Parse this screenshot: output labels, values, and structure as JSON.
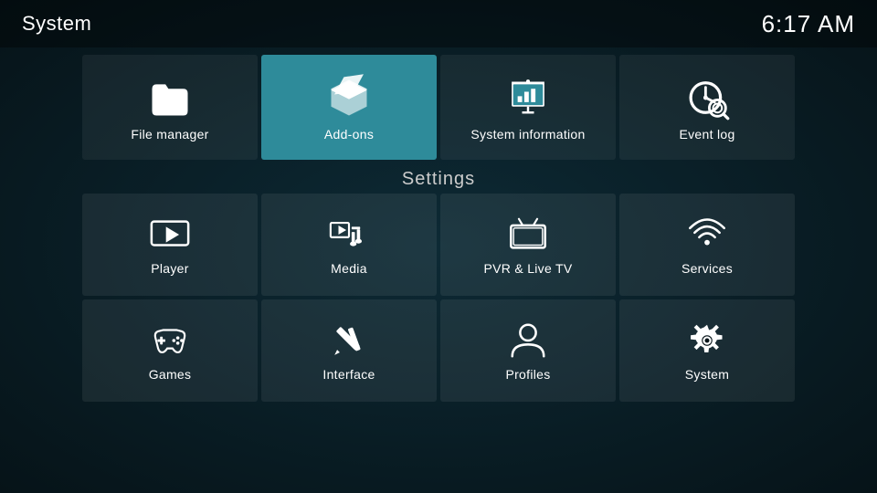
{
  "header": {
    "title": "System",
    "clock": "6:17 AM"
  },
  "top_items": [
    {
      "id": "file-manager",
      "label": "File manager",
      "active": false
    },
    {
      "id": "add-ons",
      "label": "Add-ons",
      "active": true
    },
    {
      "id": "system-information",
      "label": "System information",
      "active": false
    },
    {
      "id": "event-log",
      "label": "Event log",
      "active": false
    }
  ],
  "settings_label": "Settings",
  "grid_row1": [
    {
      "id": "player",
      "label": "Player"
    },
    {
      "id": "media",
      "label": "Media"
    },
    {
      "id": "pvr-live-tv",
      "label": "PVR & Live TV"
    },
    {
      "id": "services",
      "label": "Services"
    }
  ],
  "grid_row2": [
    {
      "id": "games",
      "label": "Games"
    },
    {
      "id": "interface",
      "label": "Interface"
    },
    {
      "id": "profiles",
      "label": "Profiles"
    },
    {
      "id": "system",
      "label": "System"
    }
  ]
}
